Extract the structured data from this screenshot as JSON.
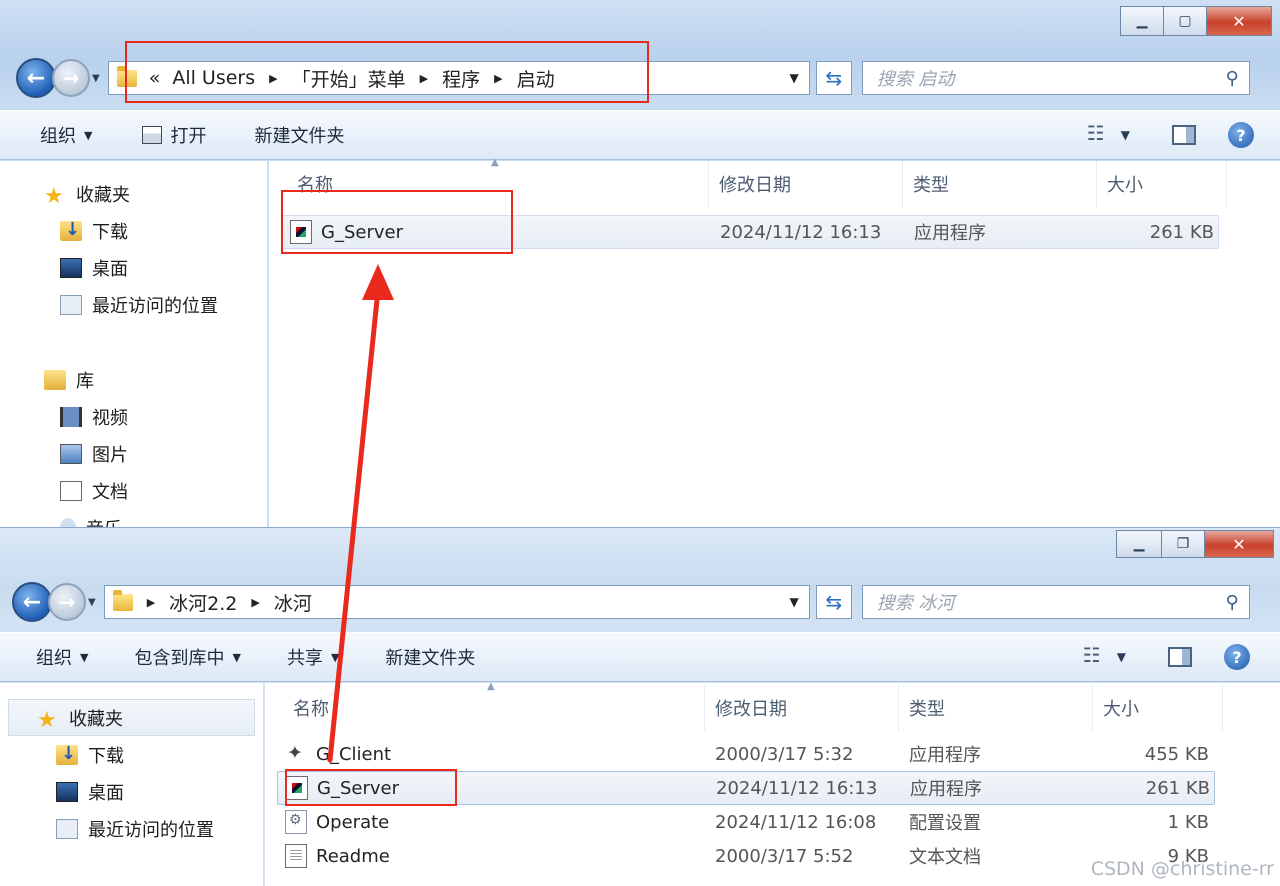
{
  "top_window": {
    "breadcrumb": {
      "overflow": "«",
      "items": [
        "All Users",
        "「开始」菜单",
        "程序",
        "启动"
      ]
    },
    "search_placeholder": "搜索 启动",
    "toolbar": {
      "organize": "组织",
      "open": "打开",
      "new_folder": "新建文件夹"
    },
    "sidebar": {
      "favorites": "收藏夹",
      "favorites_items": [
        "下载",
        "桌面",
        "最近访问的位置"
      ],
      "libraries": "库",
      "library_items": [
        "视频",
        "图片",
        "文档",
        "音乐"
      ]
    },
    "columns": {
      "name": "名称",
      "modified": "修改日期",
      "type": "类型",
      "size": "大小"
    },
    "files": [
      {
        "name": "G_Server",
        "modified": "2024/11/12 16:13",
        "type": "应用程序",
        "size": "261 KB",
        "icon": "exe-icon"
      }
    ]
  },
  "bottom_window": {
    "breadcrumb": {
      "items": [
        "冰河2.2",
        "冰河"
      ]
    },
    "search_placeholder": "搜索 冰河",
    "toolbar": {
      "organize": "组织",
      "include_library": "包含到库中",
      "share": "共享",
      "new_folder": "新建文件夹"
    },
    "sidebar": {
      "favorites": "收藏夹",
      "favorites_items": [
        "下载",
        "桌面",
        "最近访问的位置"
      ]
    },
    "columns": {
      "name": "名称",
      "modified": "修改日期",
      "type": "类型",
      "size": "大小"
    },
    "files": [
      {
        "name": "G_Client",
        "modified": "2000/3/17 5:32",
        "type": "应用程序",
        "size": "455 KB",
        "icon": "client-exe-icon"
      },
      {
        "name": "G_Server",
        "modified": "2024/11/12 16:13",
        "type": "应用程序",
        "size": "261 KB",
        "icon": "exe-icon"
      },
      {
        "name": "Operate",
        "modified": "2024/11/12 16:08",
        "type": "配置设置",
        "size": "1 KB",
        "icon": "config-icon"
      },
      {
        "name": "Readme",
        "modified": "2000/3/17 5:52",
        "type": "文本文档",
        "size": "9 KB",
        "icon": "text-file-icon"
      }
    ]
  },
  "annotation_color": "#e8291c",
  "watermark": "CSDN @christine-rr"
}
